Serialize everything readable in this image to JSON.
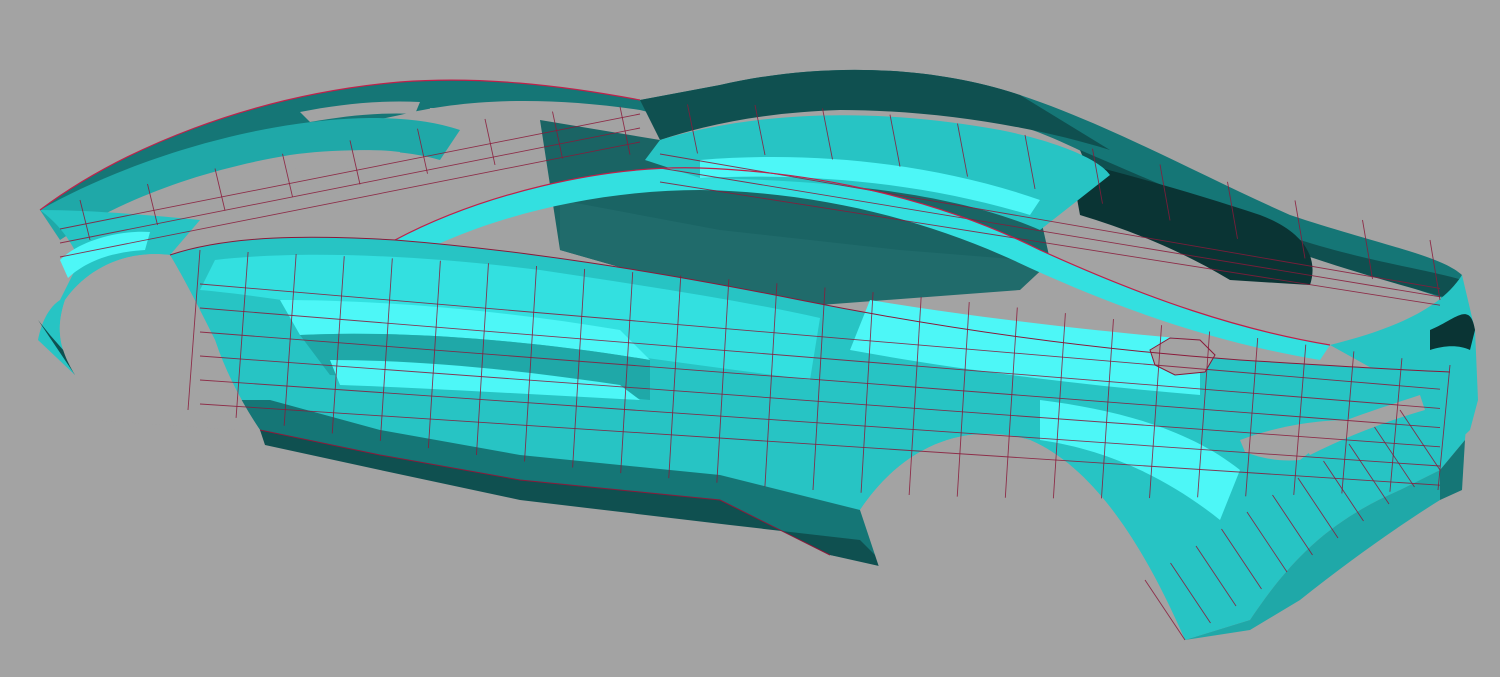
{
  "viewport": {
    "background": "#a3a3a3",
    "model": "car-body-surface-mesh",
    "shading": "flat-quad-mesh",
    "palette": {
      "bright": "#4df7f7",
      "light": "#33e0e0",
      "mid": "#27c4c4",
      "base": "#1fa8a8",
      "dark": "#157676",
      "darker": "#0f5050",
      "darkest": "#0a3434",
      "edge": "#8a1a3a",
      "edge_highlight": "#c0204a"
    }
  }
}
